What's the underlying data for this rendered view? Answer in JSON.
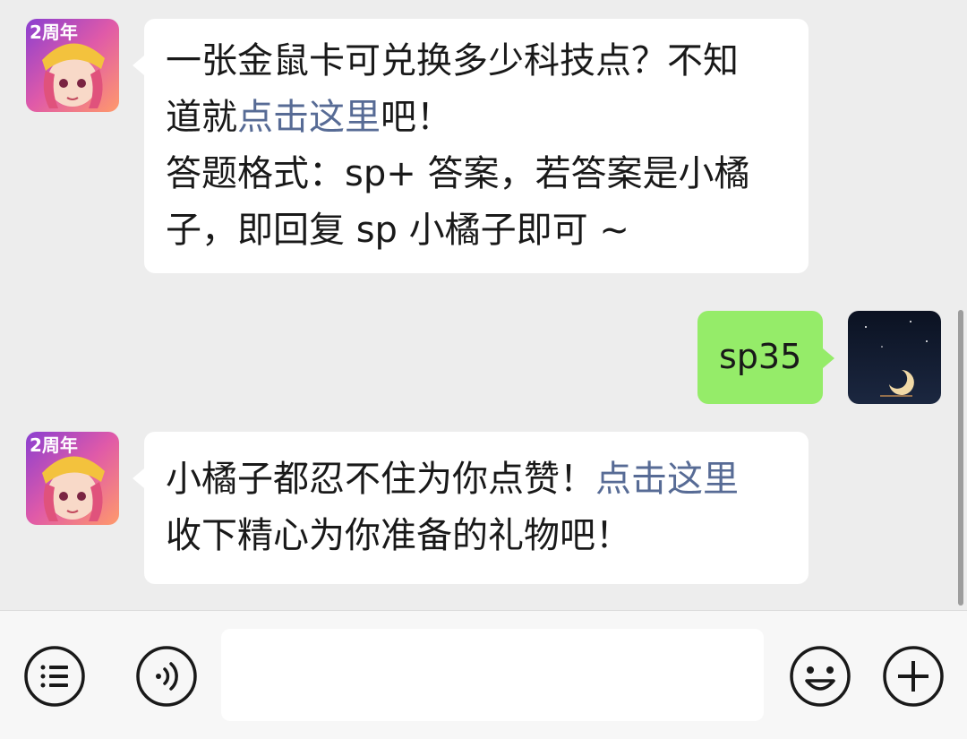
{
  "messages": [
    {
      "sender": "official-account",
      "direction": "incoming",
      "lines": [
        {
          "text": "一张金鼠卡可兑换多少科技点？不知"
        },
        {
          "pre": "道就",
          "link": "点击这里",
          "post": "吧！"
        },
        {
          "text": "答题格式：sp+ 答案，若答案是小橘"
        },
        {
          "text": "子，即回复 sp 小橘子即可 ~"
        }
      ]
    },
    {
      "sender": "me",
      "direction": "outgoing",
      "text": "sp35"
    },
    {
      "sender": "official-account",
      "direction": "incoming",
      "lines": [
        {
          "pre": "小橘子都忍不住为你点赞！",
          "link": "点击这里"
        },
        {
          "text": "收下精心为你准备的礼物吧！"
        }
      ]
    }
  ],
  "colors": {
    "chat_background": "#ededed",
    "incoming_bubble": "#ffffff",
    "outgoing_bubble": "#95ec69",
    "link": "#576b95",
    "text": "#191919"
  },
  "avatars": {
    "official": {
      "icon": "game-character-avatar-icon",
      "badge": "2周年"
    },
    "me": {
      "icon": "crescent-moon-night-avatar-icon"
    }
  },
  "input_bar": {
    "left_icons": [
      "menu-list-icon",
      "voice-icon"
    ],
    "right_icons": [
      "emoji-icon",
      "plus-icon"
    ],
    "input_value": ""
  }
}
